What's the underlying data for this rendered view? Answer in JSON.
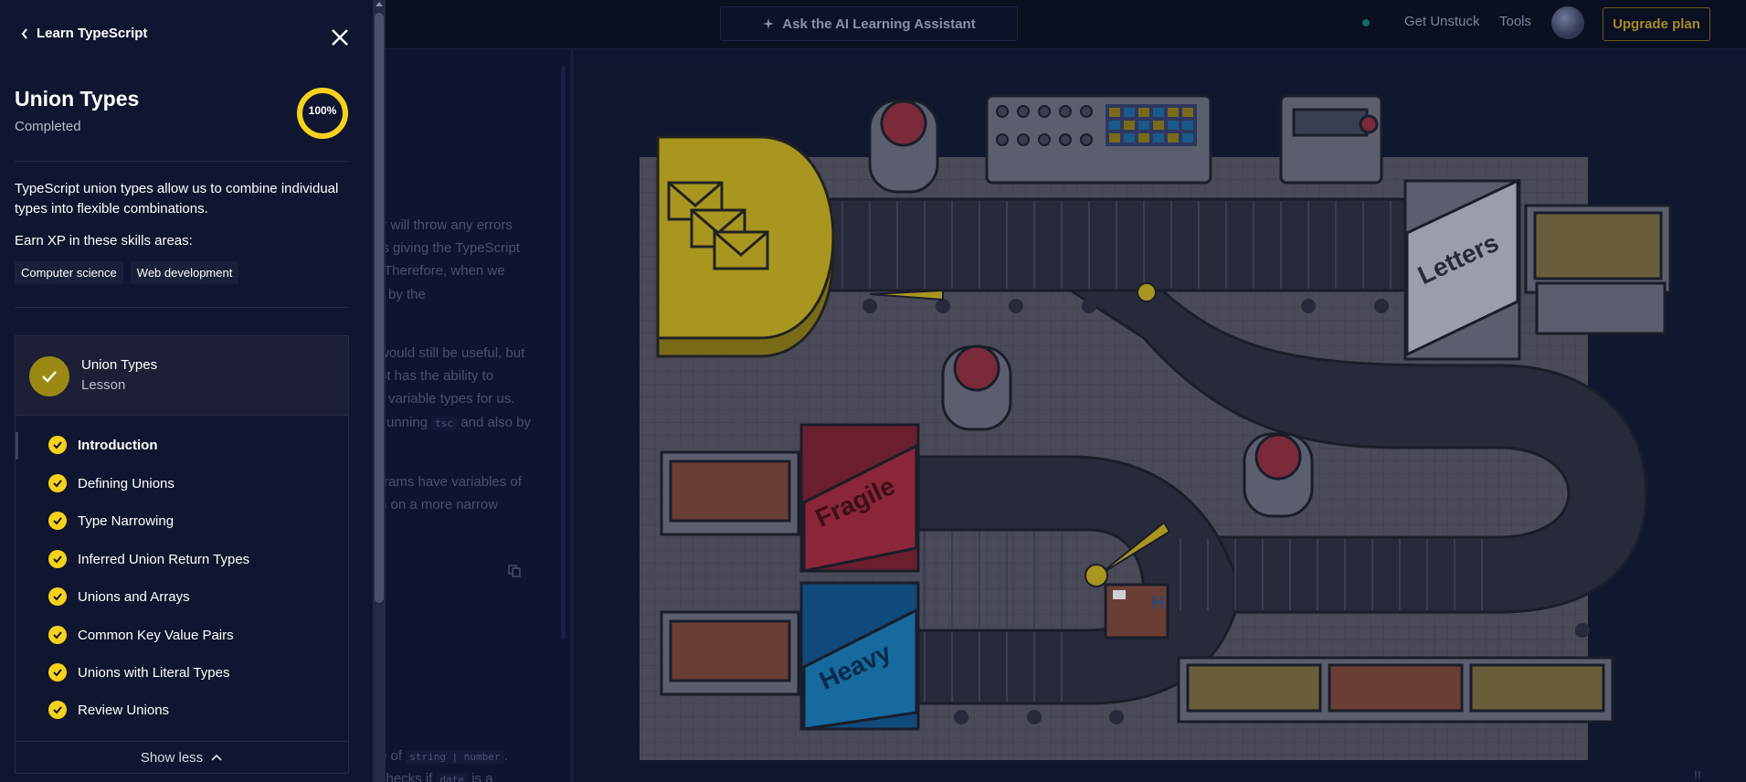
{
  "topbar": {
    "ask_label": "Ask the AI Learning Assistant",
    "get_unstuck": "Get Unstuck",
    "tools": "Tools",
    "upgrade": "Upgrade plan"
  },
  "background_content": {
    "lines": [
      "er will throw any errors",
      "es giving the TypeScript",
      "Therefore, when we",
      "by the",
      "would still be useful, but",
      "pt has the ability to",
      "variable types for us.",
      "unning",
      "and also by",
      "rams have variables of",
      "n on a more narrow",
      "e of",
      "checks if",
      "is a"
    ],
    "code_tsc": "tsc",
    "code_union": "string | number",
    "code_date": "date"
  },
  "sidebar": {
    "back_label": "Learn TypeScript",
    "title": "Union Types",
    "status": "Completed",
    "progress_percent": 100,
    "progress_label": "100%",
    "description": "TypeScript union types allow us to combine individual types into flexible combinations.",
    "earn_label": "Earn XP in these skills areas:",
    "tags": [
      "Computer science",
      "Web development"
    ],
    "lesson": {
      "name": "Union Types",
      "type": "Lesson"
    },
    "items": [
      {
        "label": "Introduction",
        "active": true
      },
      {
        "label": "Defining Unions"
      },
      {
        "label": "Type Narrowing"
      },
      {
        "label": "Inferred Union Return Types"
      },
      {
        "label": "Unions and Arrays"
      },
      {
        "label": "Common Key Value Pairs"
      },
      {
        "label": "Unions with Literal Types"
      },
      {
        "label": "Review Unions"
      }
    ],
    "show_less": "Show less"
  },
  "illustration": {
    "box_letters": "Letters",
    "box_fragile": "Fragile",
    "box_heavy": "Heavy",
    "box_h": "H"
  },
  "colors": {
    "accent_yellow": "#f7d21d",
    "sidebar_bg": "#10162f",
    "upgrade_gold": "#a68a25"
  }
}
